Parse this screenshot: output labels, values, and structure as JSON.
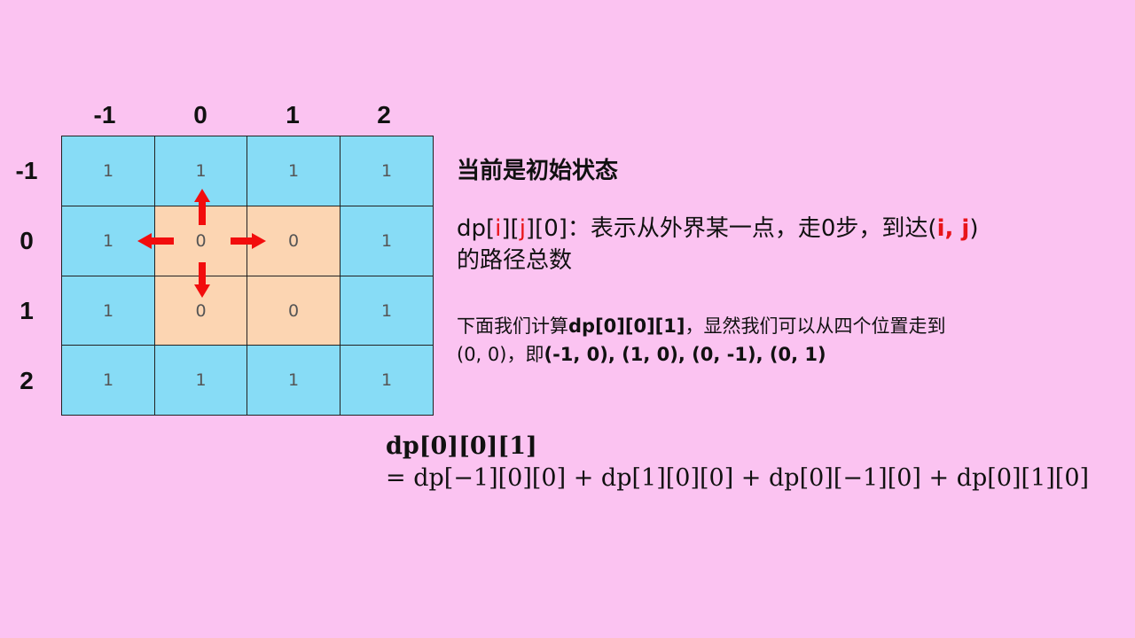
{
  "column_labels": [
    "-1",
    "0",
    "1",
    "2"
  ],
  "row_labels": [
    "-1",
    "0",
    "1",
    "2"
  ],
  "grid": {
    "rows": [
      [
        "1",
        "1",
        "1",
        "1"
      ],
      [
        "1",
        "0",
        "0",
        "1"
      ],
      [
        "1",
        "0",
        "0",
        "1"
      ],
      [
        "1",
        "1",
        "1",
        "1"
      ]
    ],
    "colors": {
      "outer": "#87dcf6",
      "inner": "#fcd5b2",
      "arrow": "#f20d0d",
      "background": "#fbc3f1"
    }
  },
  "state_title": "当前是初始状态",
  "definition": {
    "prefix": "dp[",
    "i": "i",
    "mid1": "][",
    "j": "j",
    "mid2": "][0]：表示从外界某一点，走0步，到达(",
    "ij": "i, j",
    "suffix": ")",
    "line2": "的路径总数"
  },
  "calc": {
    "part1": "下面我们计算",
    "target": "dp[0][0][1]",
    "part2": "，显然我们可以从四个位置走到",
    "part3": "(0, 0)，即",
    "positions": "(-1, 0), (1, 0), (0, -1), (0, 1)"
  },
  "formula": {
    "lhs": "dp[0][0][1]",
    "rhs": "= dp[−1][0][0] + dp[1][0][0] + dp[0][−1][0] + dp[0][1][0]"
  }
}
